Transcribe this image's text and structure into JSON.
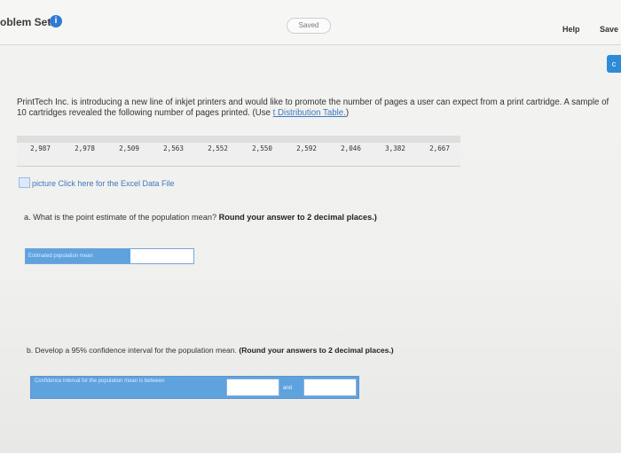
{
  "header": {
    "title": "oblem Set",
    "saved_label": "Saved",
    "help_label": "Help",
    "save_label": "Save",
    "side_tab_label": "c"
  },
  "question": {
    "text": "PrintTech Inc. is introducing a new line of inkjet printers and would like to promote the number of pages a user can expect from a print cartridge. A sample of 10 cartridges revealed the following number of pages printed. (Use",
    "link_text": "t Distribution Table.",
    "closing": ")"
  },
  "sample_values": [
    "2,987",
    "2,978",
    "2,509",
    "2,563",
    "2,552",
    "2,550",
    "2,592",
    "2,046",
    "3,382",
    "2,667"
  ],
  "excel_link": "picture Click here for the Excel Data File",
  "part_a": {
    "prompt": "a. What is the point estimate of the population mean?",
    "instruction": "Round your answer to 2 decimal places.)",
    "answer_label": "Estimated population mean"
  },
  "part_b": {
    "prompt": "b. Develop a 95% confidence interval for the population mean.",
    "instruction": "(Round your answers to 2 decimal places.)",
    "ci_label": "Confidence interval for the population mean is between",
    "and_label": "and"
  }
}
